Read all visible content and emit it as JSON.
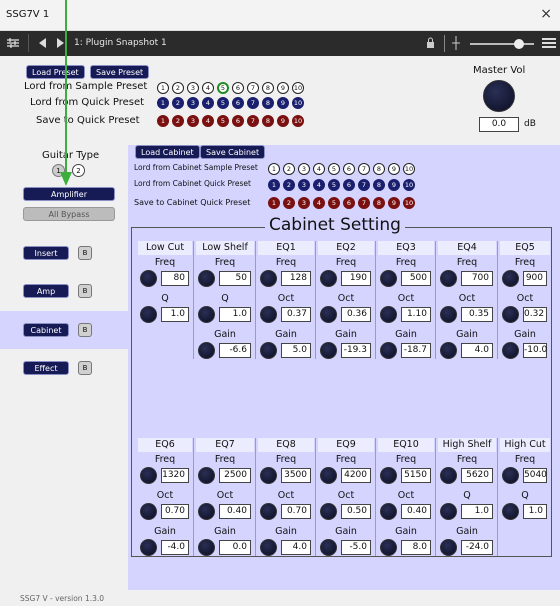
{
  "window": {
    "title": "SSG7V 1",
    "close": "×"
  },
  "host": {
    "preset_label": "1: Plugin Snapshot 1"
  },
  "top": {
    "load_preset": "Load Preset",
    "save_preset": "Save Preset",
    "lord_sample": "Lord from Sample Preset",
    "lord_quick": "Lord from Quick Preset",
    "save_quick": "Save to Quick Preset",
    "numbers": [
      "1",
      "2",
      "3",
      "4",
      "5",
      "6",
      "7",
      "8",
      "9",
      "10"
    ],
    "selected_sample": "5",
    "master_vol_label": "Master Vol",
    "master_vol_value": "0.0",
    "master_vol_unit": "dB"
  },
  "sidebar": {
    "guitar_type_label": "Guitar Type",
    "guitar_types": [
      "1",
      "2"
    ],
    "amplifier": "Amplifier",
    "all_bypass": "All Bypass",
    "insert": "Insert",
    "amp": "Amp",
    "cabinet": "Cabinet",
    "effect": "Effect",
    "bypass_label": "B",
    "version": "SSG7 V - version 1.3.0"
  },
  "cabinet": {
    "load": "Load Cabinet",
    "save": "Save Cabinet",
    "lord_sample": "Lord from Cabinet Sample Preset",
    "lord_quick": "Lord from Cabinet Quick Preset",
    "save_quick": "Save to Cabinet Quick Preset",
    "title": "Cabinet Setting",
    "row1": [
      {
        "name": "Low Cut",
        "p1": "Freq",
        "v1": "80",
        "p2": "Q",
        "v2": "1.0"
      },
      {
        "name": "Low Shelf",
        "p1": "Freq",
        "v1": "50",
        "p2": "Q",
        "v2": "1.0",
        "p3": "Gain",
        "v3": "-6.6"
      },
      {
        "name": "EQ1",
        "p1": "Freq",
        "v1": "128",
        "p2": "Oct",
        "v2": "0.37",
        "p3": "Gain",
        "v3": "5.0"
      },
      {
        "name": "EQ2",
        "p1": "Freq",
        "v1": "190",
        "p2": "Oct",
        "v2": "0.36",
        "p3": "Gain",
        "v3": "-19.3"
      },
      {
        "name": "EQ3",
        "p1": "Freq",
        "v1": "500",
        "p2": "Oct",
        "v2": "1.10",
        "p3": "Gain",
        "v3": "-18.7"
      },
      {
        "name": "EQ4",
        "p1": "Freq",
        "v1": "700",
        "p2": "Oct",
        "v2": "0.35",
        "p3": "Gain",
        "v3": "4.0"
      },
      {
        "name": "EQ5",
        "p1": "Freq",
        "v1": "900",
        "p2": "Oct",
        "v2": "0.32",
        "p3": "Gain",
        "v3": "-10.0"
      }
    ],
    "row2": [
      {
        "name": "EQ6",
        "p1": "Freq",
        "v1": "1320",
        "p2": "Oct",
        "v2": "0.70",
        "p3": "Gain",
        "v3": "-4.0"
      },
      {
        "name": "EQ7",
        "p1": "Freq",
        "v1": "2500",
        "p2": "Oct",
        "v2": "0.40",
        "p3": "Gain",
        "v3": "0.0"
      },
      {
        "name": "EQ8",
        "p1": "Freq",
        "v1": "3500",
        "p2": "Oct",
        "v2": "0.70",
        "p3": "Gain",
        "v3": "4.0"
      },
      {
        "name": "EQ9",
        "p1": "Freq",
        "v1": "4200",
        "p2": "Oct",
        "v2": "0.50",
        "p3": "Gain",
        "v3": "-5.0"
      },
      {
        "name": "EQ10",
        "p1": "Freq",
        "v1": "5150",
        "p2": "Oct",
        "v2": "0.40",
        "p3": "Gain",
        "v3": "8.0"
      },
      {
        "name": "High Shelf",
        "p1": "Freq",
        "v1": "5620",
        "p2": "Q",
        "v2": "1.0",
        "p3": "Gain",
        "v3": "-24.0"
      },
      {
        "name": "High Cut",
        "p1": "Freq",
        "v1": "5040",
        "p2": "Q",
        "v2": "1.0"
      }
    ]
  }
}
